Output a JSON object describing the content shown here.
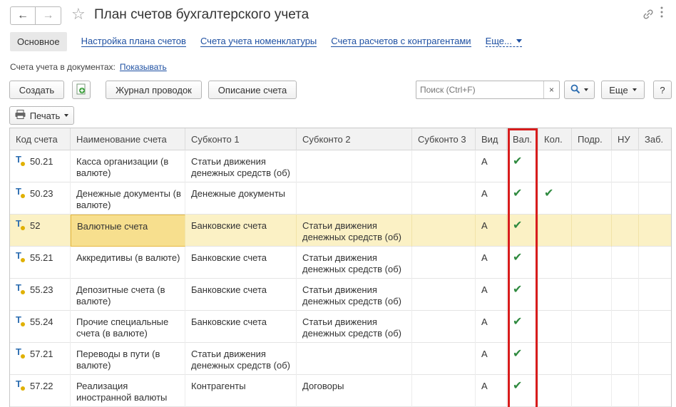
{
  "window": {
    "title": "План счетов бухгалтерского учета",
    "back_icon": "←",
    "forward_icon": "→",
    "star_icon": "☆"
  },
  "tabs": {
    "main": "Основное",
    "links": [
      "Настройка плана счетов",
      "Счета учета номенклатуры",
      "Счета расчетов с контрагентами"
    ],
    "more": "Еще..."
  },
  "accounts_in_docs": {
    "label": "Счета учета в документах:",
    "link": "Показывать"
  },
  "toolbar": {
    "create": "Создать",
    "journal": "Журнал проводок",
    "description": "Описание счета",
    "search_placeholder": "Поиск (Ctrl+F)",
    "search_clear": "×",
    "more": "Еще",
    "help": "?",
    "print": "Печать"
  },
  "table": {
    "headers": [
      "Код счета",
      "Наименование счета",
      "Субконто 1",
      "Субконто 2",
      "Субконто 3",
      "Вид",
      "Вал.",
      "Кол.",
      "Подр.",
      "НУ",
      "Заб."
    ],
    "rows": [
      {
        "code": "50.21",
        "name": "Касса организации (в валюте)",
        "sub1": "Статьи движения денежных средств (об)",
        "sub2": "",
        "sub3": "",
        "kind": "А",
        "val": "✔",
        "qty": ""
      },
      {
        "code": "50.23",
        "name": "Денежные документы (в валюте)",
        "sub1": "Денежные документы",
        "sub2": "",
        "sub3": "",
        "kind": "А",
        "val": "✔",
        "qty": "✔"
      },
      {
        "code": "52",
        "name": "Валютные счета",
        "sub1": "Банковские счета",
        "sub2": "Статьи движения денежных средств (об)",
        "sub3": "",
        "kind": "А",
        "val": "✔",
        "qty": ""
      },
      {
        "code": "55.21",
        "name": "Аккредитивы (в валюте)",
        "sub1": "Банковские счета",
        "sub2": "Статьи движения денежных средств (об)",
        "sub3": "",
        "kind": "А",
        "val": "✔",
        "qty": ""
      },
      {
        "code": "55.23",
        "name": "Депозитные счета (в валюте)",
        "sub1": "Банковские счета",
        "sub2": "Статьи движения денежных средств (об)",
        "sub3": "",
        "kind": "А",
        "val": "✔",
        "qty": ""
      },
      {
        "code": "55.24",
        "name": "Прочие специальные счета (в валюте)",
        "sub1": "Банковские счета",
        "sub2": "Статьи движения денежных средств (об)",
        "sub3": "",
        "kind": "А",
        "val": "✔",
        "qty": ""
      },
      {
        "code": "57.21",
        "name": "Переводы в пути (в валюте)",
        "sub1": "Статьи движения денежных средств (об)",
        "sub2": "",
        "sub3": "",
        "kind": "А",
        "val": "✔",
        "qty": ""
      },
      {
        "code": "57.22",
        "name": "Реализация иностранной валюты",
        "sub1": "Контрагенты",
        "sub2": "Договоры",
        "sub3": "",
        "kind": "А",
        "val": "✔",
        "qty": ""
      }
    ],
    "selected_row": 2
  },
  "colors": {
    "link": "#1e50a2",
    "selected_row": "#fbf1c5",
    "active_cell": "#f7df8e",
    "check": "#2f8a3f",
    "highlight_frame": "#d81d1d"
  }
}
